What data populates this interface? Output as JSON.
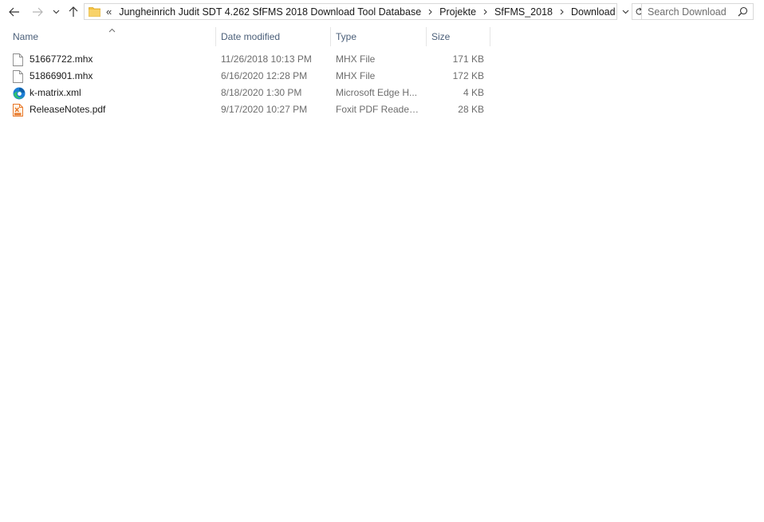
{
  "navigation": {
    "back_label": "Back",
    "forward_label": "Forward",
    "recent_label": "Recent locations",
    "up_label": "Up"
  },
  "address_bar": {
    "overflow": "«",
    "breadcrumbs": [
      "Jungheinrich Judit SDT 4.262 SfFMS 2018 Download Tool Database",
      "Projekte",
      "SfFMS_2018",
      "Download"
    ],
    "icon": "folder-icon"
  },
  "search": {
    "placeholder": "Search Download",
    "value": "",
    "icon": "search-icon"
  },
  "columns": {
    "name": "Name",
    "date": "Date modified",
    "type": "Type",
    "size": "Size",
    "sorted_by": "Name"
  },
  "files": [
    {
      "name": "51667722.mhx",
      "date": "11/26/2018 10:13 PM",
      "type": "MHX File",
      "size": "171 KB",
      "icon": "generic-file-icon"
    },
    {
      "name": "51866901.mhx",
      "date": "6/16/2020 12:28 PM",
      "type": "MHX File",
      "size": "172 KB",
      "icon": "generic-file-icon"
    },
    {
      "name": "k-matrix.xml",
      "date": "8/18/2020 1:30 PM",
      "type": "Microsoft Edge H...",
      "size": "4 KB",
      "icon": "edge-icon"
    },
    {
      "name": "ReleaseNotes.pdf",
      "date": "9/17/2020 10:27 PM",
      "type": "Foxit PDF Reader ...",
      "size": "28 KB",
      "icon": "pdf-icon"
    }
  ],
  "colors": {
    "header_text": "#4c607a",
    "secondary_text": "#6d6d6d",
    "border": "#d9d9d9",
    "folder": "#f5c242",
    "edge_blue": "#1c7ed6",
    "edge_green": "#2fbf71",
    "pdf_orange": "#e8782a"
  }
}
